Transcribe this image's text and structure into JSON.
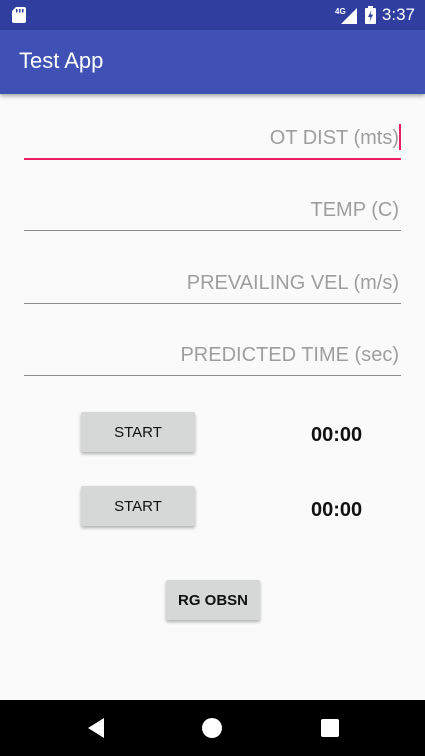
{
  "status_bar": {
    "network_label": "4G",
    "time": "3:37"
  },
  "app_bar": {
    "title": "Test App"
  },
  "form": {
    "fields": [
      {
        "placeholder": "OT DIST (mts)",
        "value": ""
      },
      {
        "placeholder": "TEMP (C)",
        "value": ""
      },
      {
        "placeholder": "PREVAILING VEL (m/s)",
        "value": ""
      },
      {
        "placeholder": "PREDICTED TIME (sec)",
        "value": ""
      }
    ]
  },
  "timers": [
    {
      "button_label": "START",
      "display": "00:00"
    },
    {
      "button_label": "START",
      "display": "00:00"
    }
  ],
  "actions": {
    "rg_obsn_label": "RG OBSN"
  },
  "colors": {
    "status_bar": "#303f9f",
    "app_bar": "#3f51b5",
    "accent": "#e91e63"
  }
}
